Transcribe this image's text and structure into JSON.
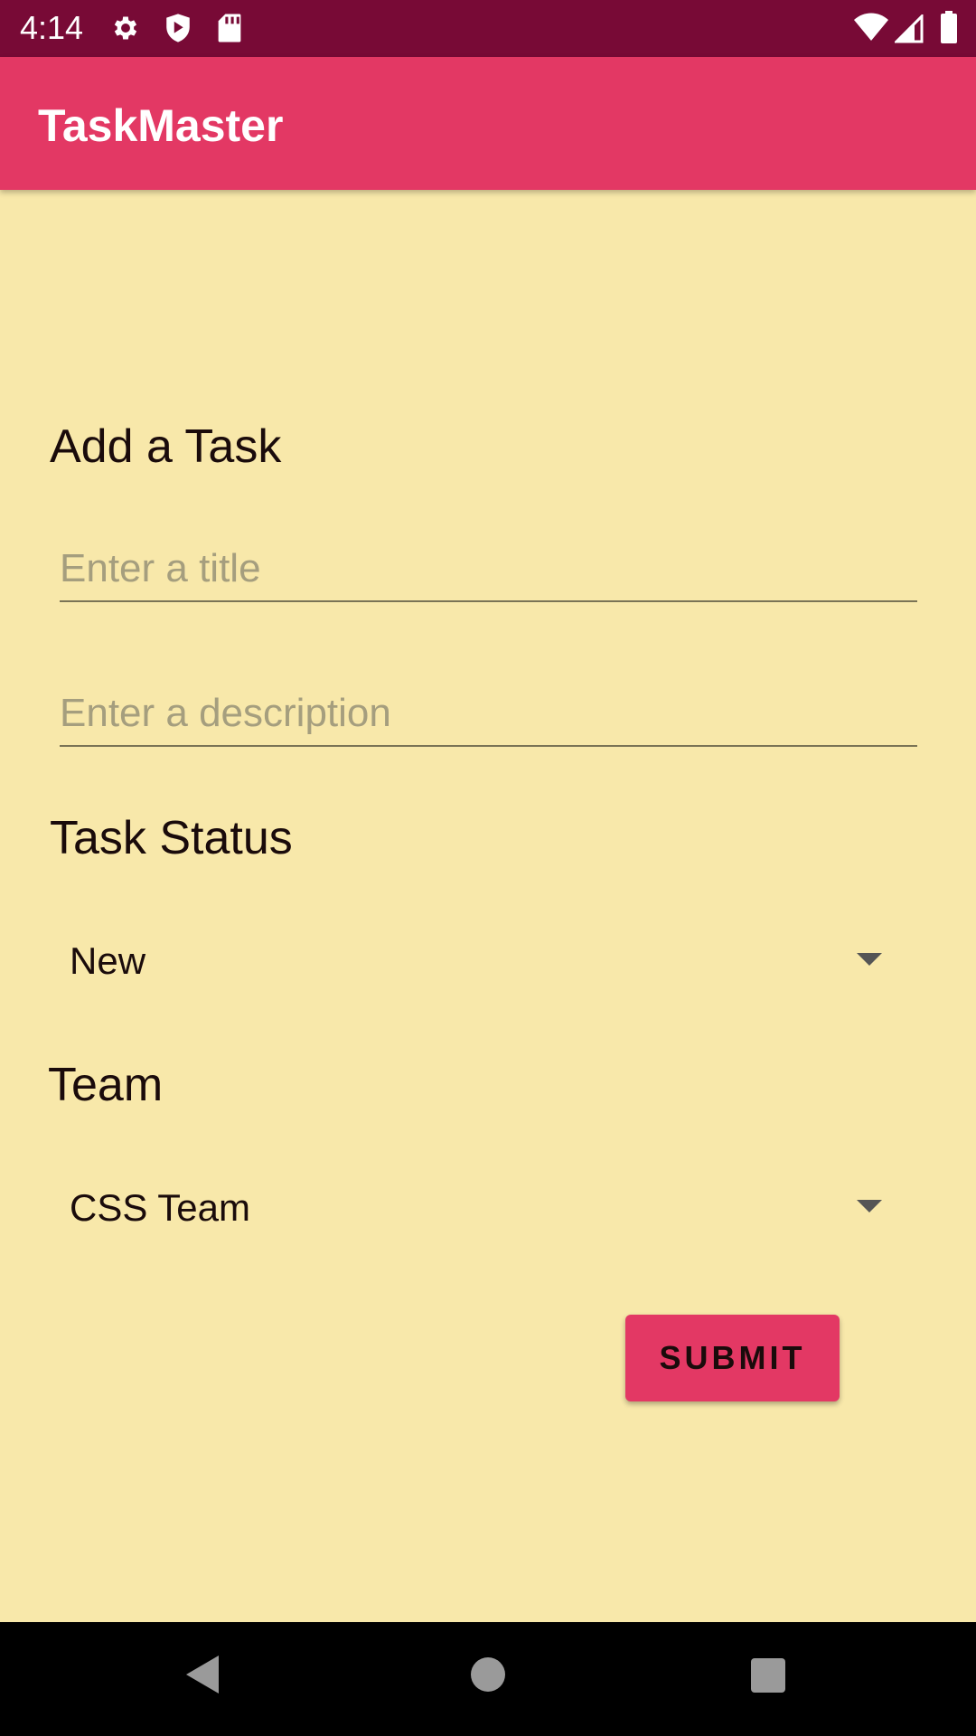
{
  "status_bar": {
    "time": "4:14",
    "icons": [
      "gear-icon",
      "shield-icon",
      "sd-card-icon",
      "wifi-icon",
      "signal-icon",
      "battery-icon"
    ]
  },
  "app_bar": {
    "title": "TaskMaster"
  },
  "form": {
    "heading": "Add a Task",
    "title_field": {
      "value": "",
      "placeholder": "Enter a title"
    },
    "description_field": {
      "value": "",
      "placeholder": "Enter a description"
    },
    "status_label": "Task Status",
    "status_selected": "New",
    "team_label": "Team",
    "team_selected": "CSS Team",
    "submit_label": "SUBMIT"
  },
  "nav_bar": {
    "icons": [
      "back-icon",
      "home-icon",
      "recents-icon"
    ]
  },
  "colors": {
    "status_bar": "#780A36",
    "app_bar": "#E33864",
    "background": "#F8E8AA",
    "button": "#E33864"
  }
}
